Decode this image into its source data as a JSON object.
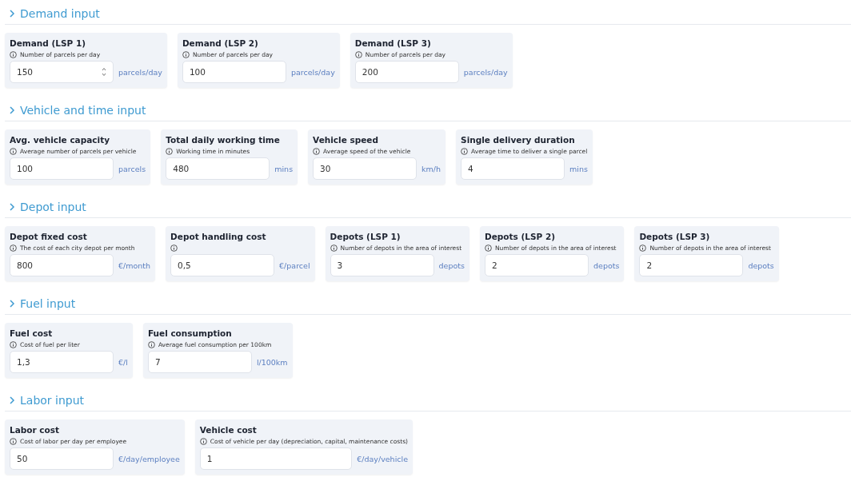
{
  "sections": [
    {
      "title": "Demand input",
      "fields": [
        {
          "label": "Demand (LSP 1)",
          "hint": "Number of parcels per day",
          "value": "150",
          "unit": "parcels/day",
          "stepper": true
        },
        {
          "label": "Demand (LSP 2)",
          "hint": "Number of parcels per day",
          "value": "100",
          "unit": "parcels/day",
          "stepper": false
        },
        {
          "label": "Demand (LSP 3)",
          "hint": "Number of parcels per day",
          "value": "200",
          "unit": "parcels/day",
          "stepper": false
        }
      ]
    },
    {
      "title": "Vehicle and time input",
      "fields": [
        {
          "label": "Avg. vehicle capacity",
          "hint": "Average number of parcels per vehicle",
          "value": "100",
          "unit": "parcels",
          "stepper": false
        },
        {
          "label": "Total daily working time",
          "hint": "Working time in minutes",
          "value": "480",
          "unit": "mins",
          "stepper": false
        },
        {
          "label": "Vehicle speed",
          "hint": "Average speed of the vehicle",
          "value": "30",
          "unit": "km/h",
          "stepper": false
        },
        {
          "label": "Single delivery duration",
          "hint": "Average time to deliver a single parcel",
          "value": "4",
          "unit": "mins",
          "stepper": false
        }
      ]
    },
    {
      "title": "Depot input",
      "fields": [
        {
          "label": "Depot fixed cost",
          "hint": "The cost of each city depot per month",
          "value": "800",
          "unit": "€/month",
          "stepper": false
        },
        {
          "label": "Depot handling cost",
          "value": "0,5",
          "unit": "€/parcel",
          "stepper": false
        },
        {
          "label": "Depots (LSP 1)",
          "hint": "Number of depots in the area of interest",
          "value": "3",
          "unit": "depots",
          "stepper": false
        },
        {
          "label": "Depots (LSP 2)",
          "hint": "Number of depots in the area of interest",
          "value": "2",
          "unit": "depots",
          "stepper": false
        },
        {
          "label": "Depots (LSP 3)",
          "hint": "Number of depots in the area of interest",
          "value": "2",
          "unit": "depots",
          "stepper": false
        }
      ]
    },
    {
      "title": "Fuel input",
      "fields": [
        {
          "label": "Fuel cost",
          "hint": "Cost of fuel per liter",
          "value": "1,3",
          "unit": "€/l",
          "stepper": false
        },
        {
          "label": "Fuel consumption",
          "hint": "Average fuel consumption per 100km",
          "value": "7",
          "unit": "l/100km",
          "stepper": false
        }
      ]
    },
    {
      "title": "Labor input",
      "fields": [
        {
          "label": "Labor cost",
          "hint": "Cost of labor per day per employee",
          "value": "50",
          "unit": "€/day/employee",
          "stepper": false
        },
        {
          "label": "Vehicle cost",
          "hint": "Cost of vehicle per day (depreciation, capital, maintenance costs)",
          "value": "1",
          "unit": "€/day/vehicle",
          "stepper": false
        }
      ]
    }
  ]
}
